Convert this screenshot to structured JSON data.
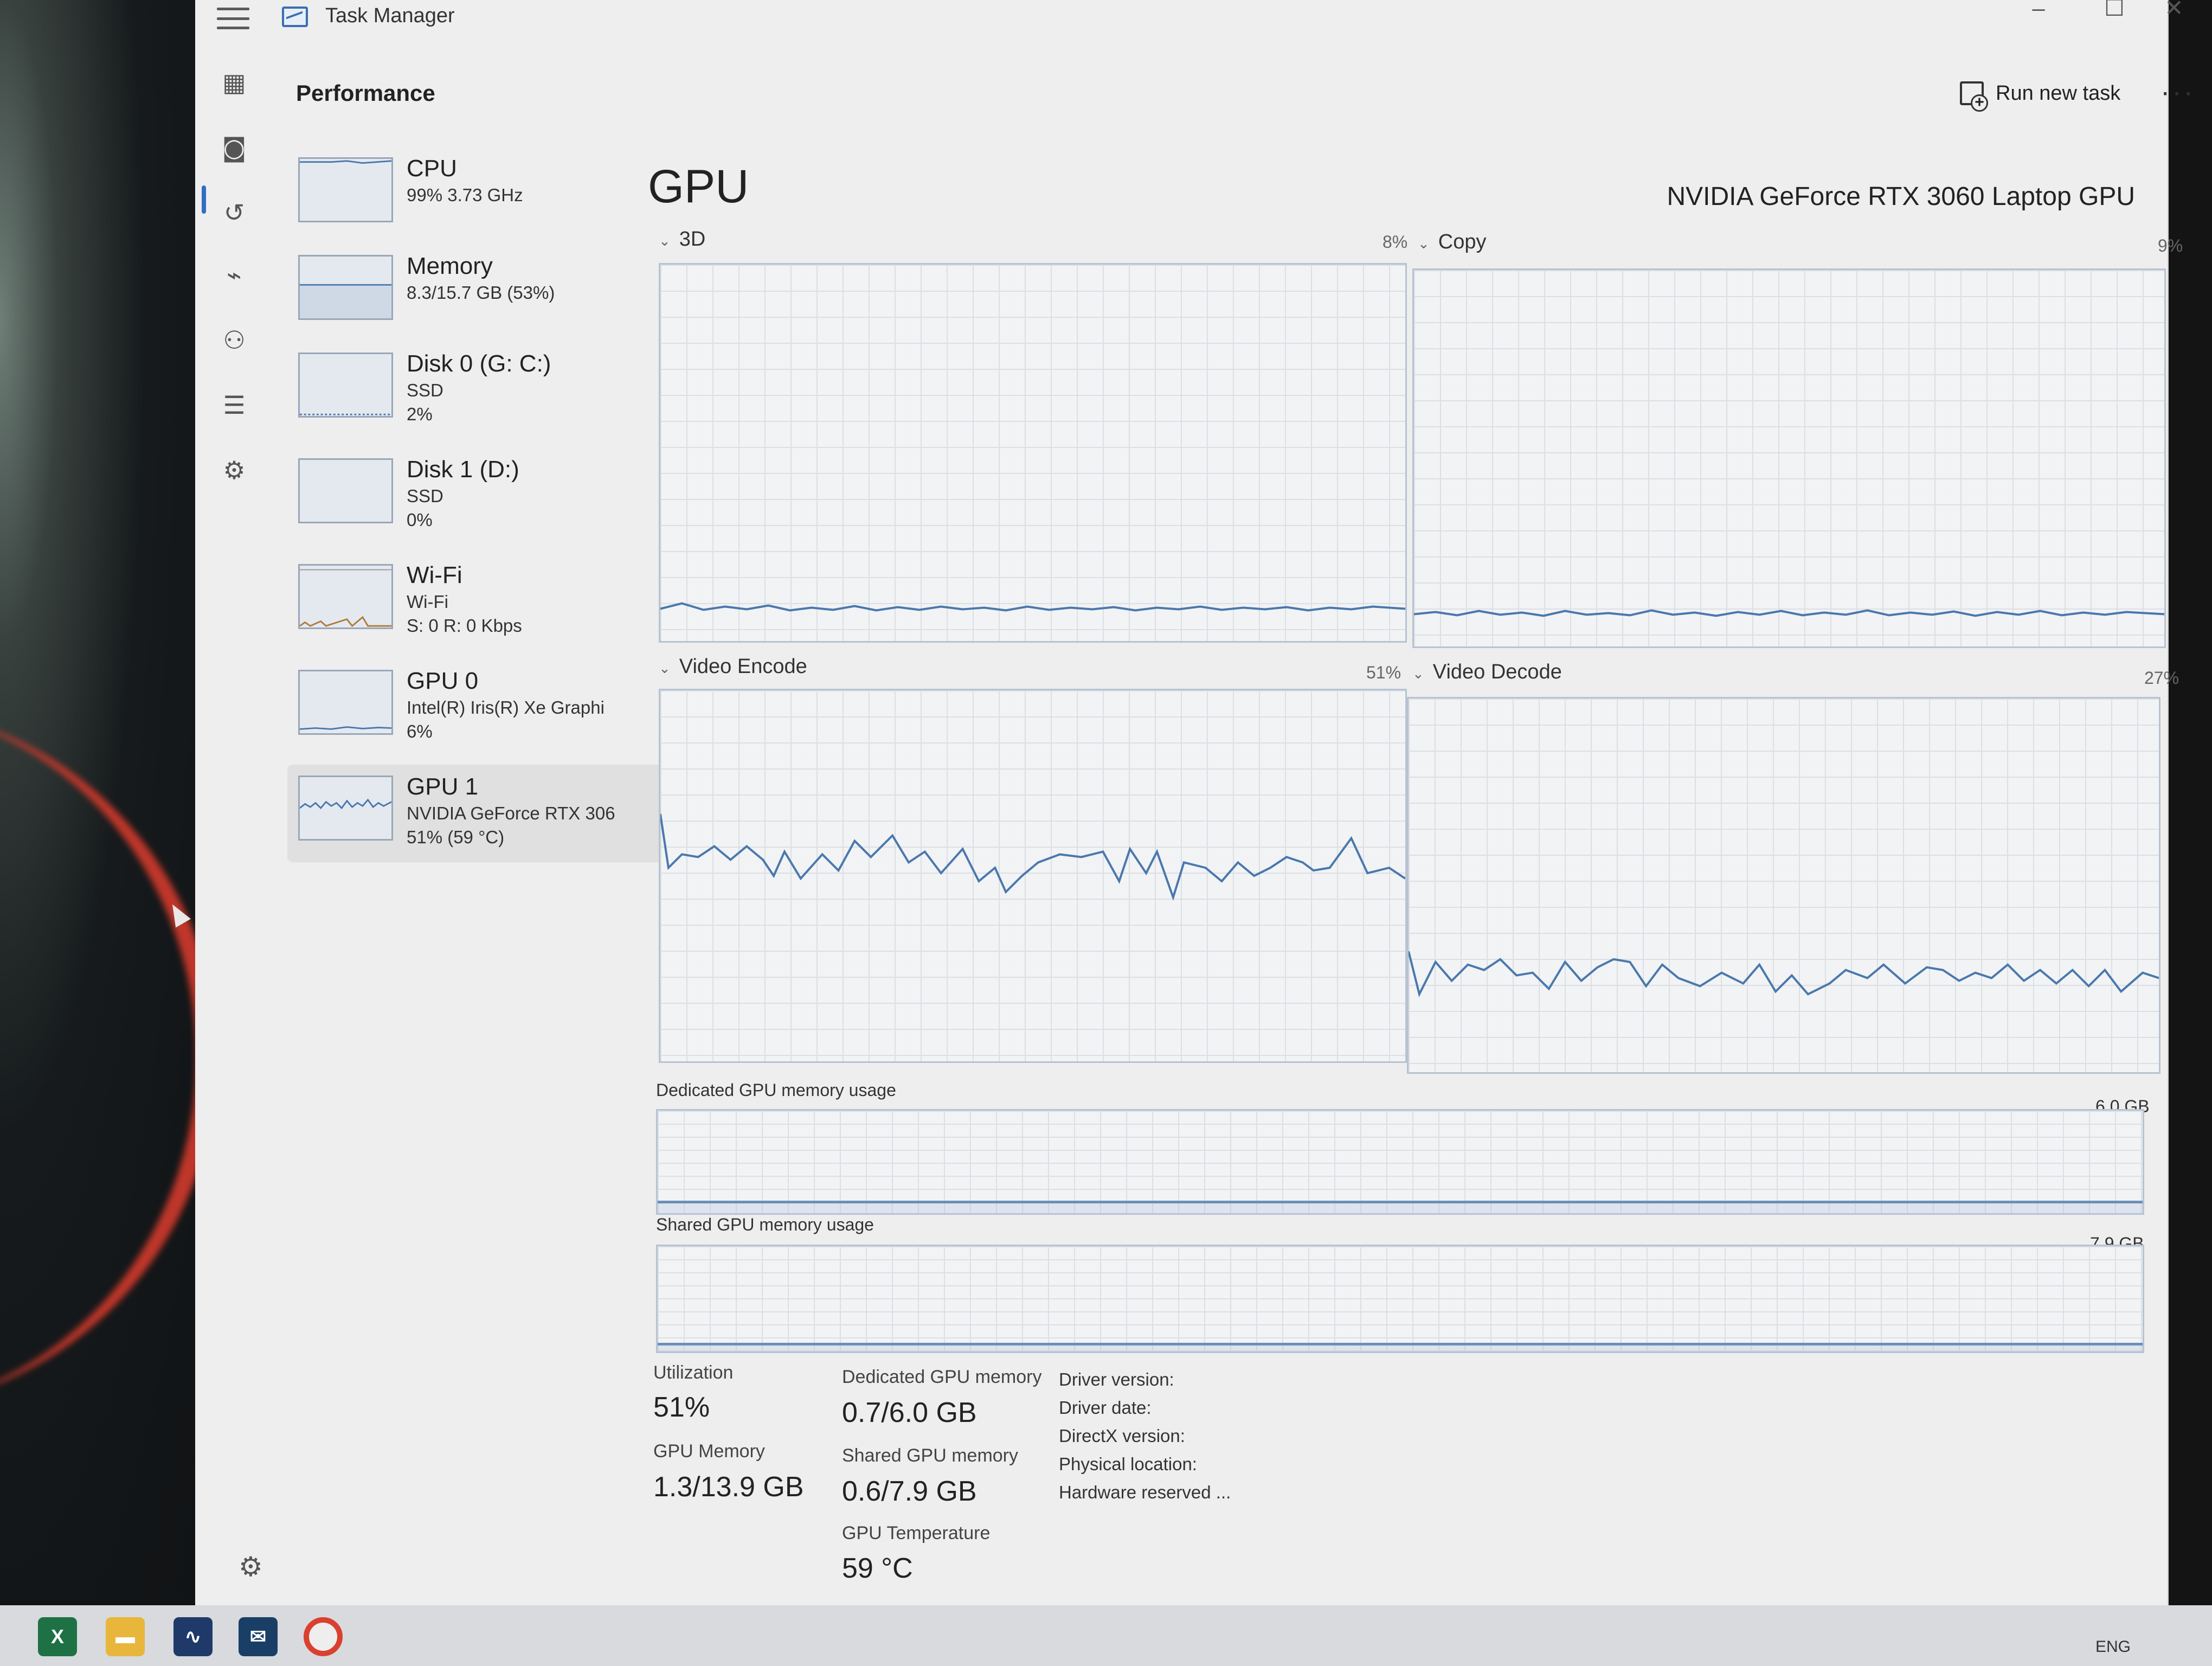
{
  "window": {
    "title": "Task Manager"
  },
  "header": {
    "page_title": "Performance",
    "run_task_label": "Run new task",
    "more_label": "···"
  },
  "devices": [
    {
      "name": "CPU",
      "line1": "99% 3.73 GHz",
      "line2": "",
      "line3": ""
    },
    {
      "name": "Memory",
      "line1": "8.3/15.7 GB (53%)",
      "line2": "",
      "line3": ""
    },
    {
      "name": "Disk 0 (G: C:)",
      "line1": "SSD",
      "line2": "2%",
      "line3": ""
    },
    {
      "name": "Disk 1 (D:)",
      "line1": "SSD",
      "line2": "0%",
      "line3": ""
    },
    {
      "name": "Wi-Fi",
      "line1": "Wi-Fi",
      "line2": "S: 0 R: 0 Kbps",
      "line3": ""
    },
    {
      "name": "GPU 0",
      "line1": "Intel(R) Iris(R) Xe Graphi",
      "line2": "6%",
      "line3": ""
    },
    {
      "name": "GPU 1",
      "line1": "NVIDIA GeForce RTX 306",
      "line2": "51% (59 °C)",
      "line3": ""
    }
  ],
  "gpu": {
    "title": "GPU",
    "model": "NVIDIA GeForce RTX 3060 Laptop GPU",
    "engines": [
      {
        "label": "3D",
        "pct": "8%"
      },
      {
        "label": "Copy",
        "pct": "9%"
      },
      {
        "label": "Video Encode",
        "pct": "51%"
      },
      {
        "label": "Video Decode",
        "pct": "27%"
      }
    ],
    "dedicated_mem": {
      "label": "Dedicated GPU memory usage",
      "max": "6.0 GB",
      "fraction": 0.12
    },
    "shared_mem": {
      "label": "Shared GPU memory usage",
      "max": "7.9 GB",
      "fraction": 0.08
    }
  },
  "stats": {
    "utilization_label": "Utilization",
    "utilization": "51%",
    "gpu_memory_label": "GPU Memory",
    "gpu_memory": "1.3/13.9 GB",
    "dedicated_label": "Dedicated GPU memory",
    "dedicated": "0.7/6.0 GB",
    "shared_label": "Shared GPU memory",
    "shared": "0.6/7.9 GB",
    "temp_label": "GPU Temperature",
    "temp": "59 °C"
  },
  "info": {
    "driver_version": "Driver version:",
    "driver_date": "Driver date:",
    "directx": "DirectX version:",
    "physical_location": "Physical location:",
    "hardware_reserved": "Hardware reserved ..."
  },
  "taskbar": {
    "tray_text": "ENG"
  },
  "colors": {
    "accent": "#2f6fc2",
    "graph_line": "#4a78ad",
    "graph_border": "#b7c3d2"
  },
  "icons": [
    "hamburger-icon",
    "processes-icon",
    "performance-icon",
    "app-history-icon",
    "startup-apps-icon",
    "users-icon",
    "details-icon",
    "services-icon",
    "settings-icon"
  ]
}
